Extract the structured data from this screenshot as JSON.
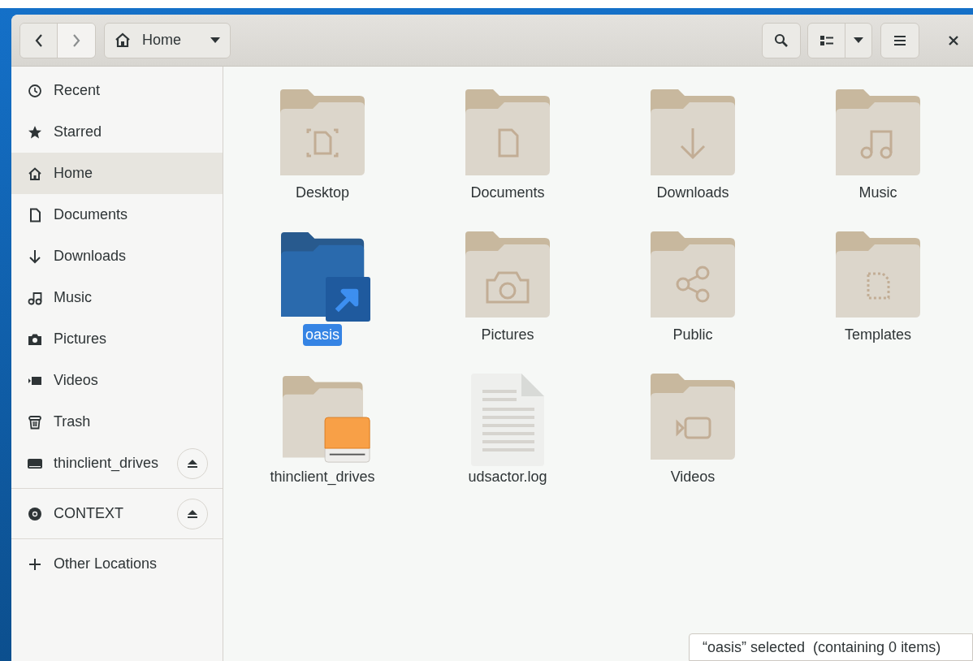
{
  "nav": {
    "back": {
      "disabled": false
    },
    "forward": {
      "disabled": true
    }
  },
  "path_bar": {
    "label": "Home"
  },
  "sidebar": {
    "sections": [
      {
        "items": [
          {
            "label": "Recent",
            "kind": "recent",
            "selected": false,
            "ejectable": false
          },
          {
            "label": "Starred",
            "kind": "starred",
            "selected": false,
            "ejectable": false
          },
          {
            "label": "Home",
            "kind": "home",
            "selected": true,
            "ejectable": false
          },
          {
            "label": "Documents",
            "kind": "documents",
            "selected": false,
            "ejectable": false
          },
          {
            "label": "Downloads",
            "kind": "downloads",
            "selected": false,
            "ejectable": false
          },
          {
            "label": "Music",
            "kind": "music",
            "selected": false,
            "ejectable": false
          },
          {
            "label": "Pictures",
            "kind": "pictures",
            "selected": false,
            "ejectable": false
          },
          {
            "label": "Videos",
            "kind": "videos",
            "selected": false,
            "ejectable": false
          },
          {
            "label": "Trash",
            "kind": "trash",
            "selected": false,
            "ejectable": false
          },
          {
            "label": "thinclient_drives",
            "kind": "drive",
            "selected": false,
            "ejectable": true
          }
        ]
      },
      {
        "items": [
          {
            "label": "CONTEXT",
            "kind": "disc",
            "selected": false,
            "ejectable": true
          }
        ]
      },
      {
        "items": [
          {
            "label": "Other Locations",
            "kind": "other",
            "selected": false,
            "ejectable": false
          }
        ]
      }
    ]
  },
  "files": [
    {
      "name": "Desktop",
      "kind": "desktop",
      "selected": false
    },
    {
      "name": "Documents",
      "kind": "documents",
      "selected": false
    },
    {
      "name": "Downloads",
      "kind": "downloads",
      "selected": false
    },
    {
      "name": "Music",
      "kind": "music",
      "selected": false
    },
    {
      "name": "oasis",
      "kind": "link",
      "selected": true
    },
    {
      "name": "Pictures",
      "kind": "pictures",
      "selected": false
    },
    {
      "name": "Public",
      "kind": "public",
      "selected": false
    },
    {
      "name": "Templates",
      "kind": "templates",
      "selected": false
    },
    {
      "name": "thinclient_drives",
      "kind": "drive",
      "selected": false
    },
    {
      "name": "udsactor.log",
      "kind": "text",
      "selected": false
    },
    {
      "name": "Videos",
      "kind": "videos",
      "selected": false
    }
  ],
  "status_bar": {
    "text": "“oasis” selected  (containing 0 items)"
  }
}
